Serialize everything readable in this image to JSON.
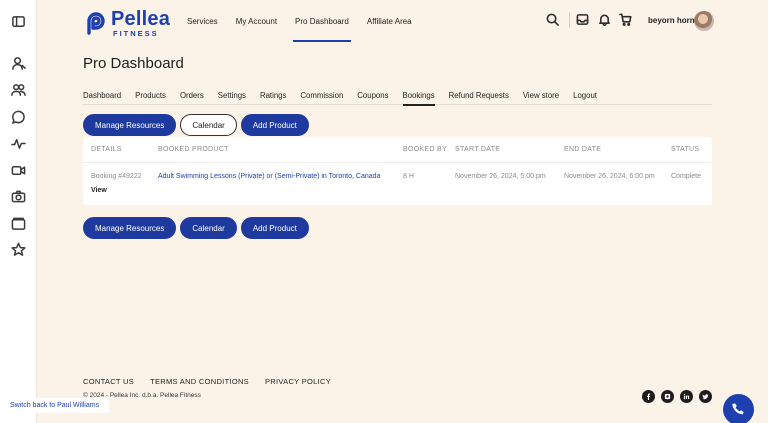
{
  "brand": {
    "name": "Pellea",
    "sub": "FITNESS",
    "color": "#1e40af"
  },
  "nav": {
    "items": [
      "Services",
      "My Account",
      "Pro Dashboard",
      "Affiliate Area"
    ],
    "active": "Pro Dashboard"
  },
  "header": {
    "icons": [
      "search-icon",
      "inbox-icon",
      "bell-icon",
      "cart-icon"
    ],
    "user_name": "beyorn horn"
  },
  "sidebar": {
    "icons": [
      "sidebar-toggle-icon",
      "user-icon",
      "users-icon",
      "chat-icon",
      "activity-icon",
      "video-icon",
      "camera-icon",
      "folder-icon",
      "star-icon"
    ]
  },
  "page": {
    "title": "Pro Dashboard"
  },
  "tabs": [
    "Dashboard",
    "Products",
    "Orders",
    "Settings",
    "Ratings",
    "Commission",
    "Coupons",
    "Bookings",
    "Refund Requests",
    "View store",
    "Logout"
  ],
  "active_tab": "Bookings",
  "buttons": {
    "manage_resources": "Manage Resources",
    "calendar": "Calendar",
    "add_product": "Add Product"
  },
  "table": {
    "headers": [
      "Details",
      "Booked Product",
      "Booked By",
      "Start Date",
      "End Date",
      "Status"
    ],
    "rows": [
      {
        "details": "Booking #49222",
        "view": "View",
        "product": "Adult Swimming Lessons (Private) or (Semi-Private) in Toronto, Canada",
        "booked_by": "8 H",
        "start": "November 26, 2024, 5:00 pm",
        "end": "November 26, 2024, 6:00 pm",
        "status": "Complete"
      }
    ]
  },
  "footer": {
    "links": [
      "CONTACT US",
      "TERMS AND CONDITIONS",
      "PRIVACY POLICY"
    ],
    "copyright": "© 2024 - Pellea Inc. d.b.a. Pellea Fitness",
    "socials": [
      "facebook-icon",
      "instagram-icon",
      "linkedin-icon",
      "twitter-icon"
    ]
  },
  "switch_back": "Switch back to Paul Williams"
}
